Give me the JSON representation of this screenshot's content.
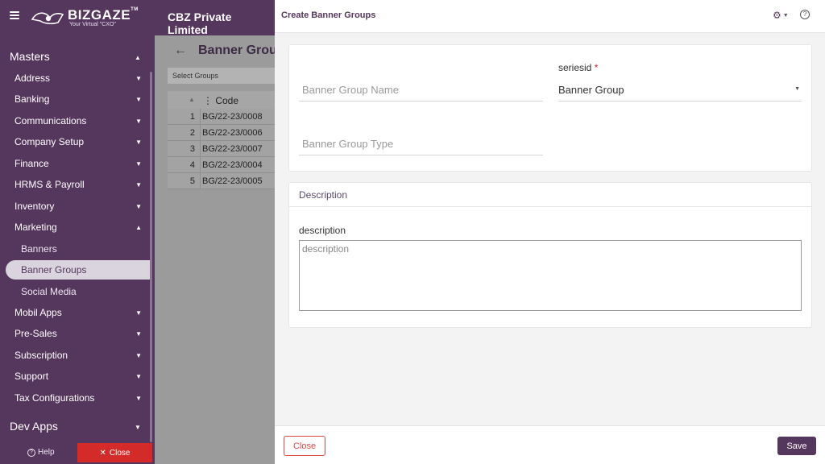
{
  "app": {
    "logo_text": "BIZGAZE",
    "logo_tm": "TM",
    "tagline": "Your Virtual \"CXO\"",
    "company": "CBZ Private Limited"
  },
  "sidebar": {
    "section_masters": "Masters",
    "items": [
      {
        "label": "Address"
      },
      {
        "label": "Banking"
      },
      {
        "label": "Communications"
      },
      {
        "label": "Company Setup"
      },
      {
        "label": "Finance"
      },
      {
        "label": "HRMS & Payroll"
      },
      {
        "label": "Inventory"
      },
      {
        "label": "Marketing"
      }
    ],
    "marketing_sub": [
      {
        "label": "Banners"
      },
      {
        "label": "Banner Groups"
      },
      {
        "label": "Social Media"
      }
    ],
    "items_after": [
      {
        "label": "Mobil Apps"
      },
      {
        "label": "Pre-Sales"
      },
      {
        "label": "Subscription"
      },
      {
        "label": "Support"
      },
      {
        "label": "Tax Configurations"
      }
    ],
    "section_devapps": "Dev Apps",
    "help_label": "Help",
    "close_label": "Close"
  },
  "background_page": {
    "title": "Banner Group",
    "select_label": "Select Groups",
    "column_code": "Code",
    "rows": [
      {
        "n": "1",
        "code": "BG/22-23/0008"
      },
      {
        "n": "2",
        "code": "BG/22-23/0006"
      },
      {
        "n": "3",
        "code": "BG/22-23/0007"
      },
      {
        "n": "4",
        "code": "BG/22-23/0004"
      },
      {
        "n": "5",
        "code": "BG/22-23/0005"
      }
    ]
  },
  "panel": {
    "title": "Create Banner Groups",
    "fields": {
      "group_name_placeholder": "Banner Group Name",
      "series_label": "seriesid",
      "series_required": "*",
      "series_value": "Banner Group",
      "group_type_placeholder": "Banner Group Type"
    },
    "description_section": {
      "title": "Description",
      "label": "description",
      "placeholder": "description"
    },
    "footer": {
      "close_label": "Close",
      "save_label": "Save"
    }
  },
  "colors": {
    "brand": "#55365d",
    "danger": "#d42a2a"
  }
}
